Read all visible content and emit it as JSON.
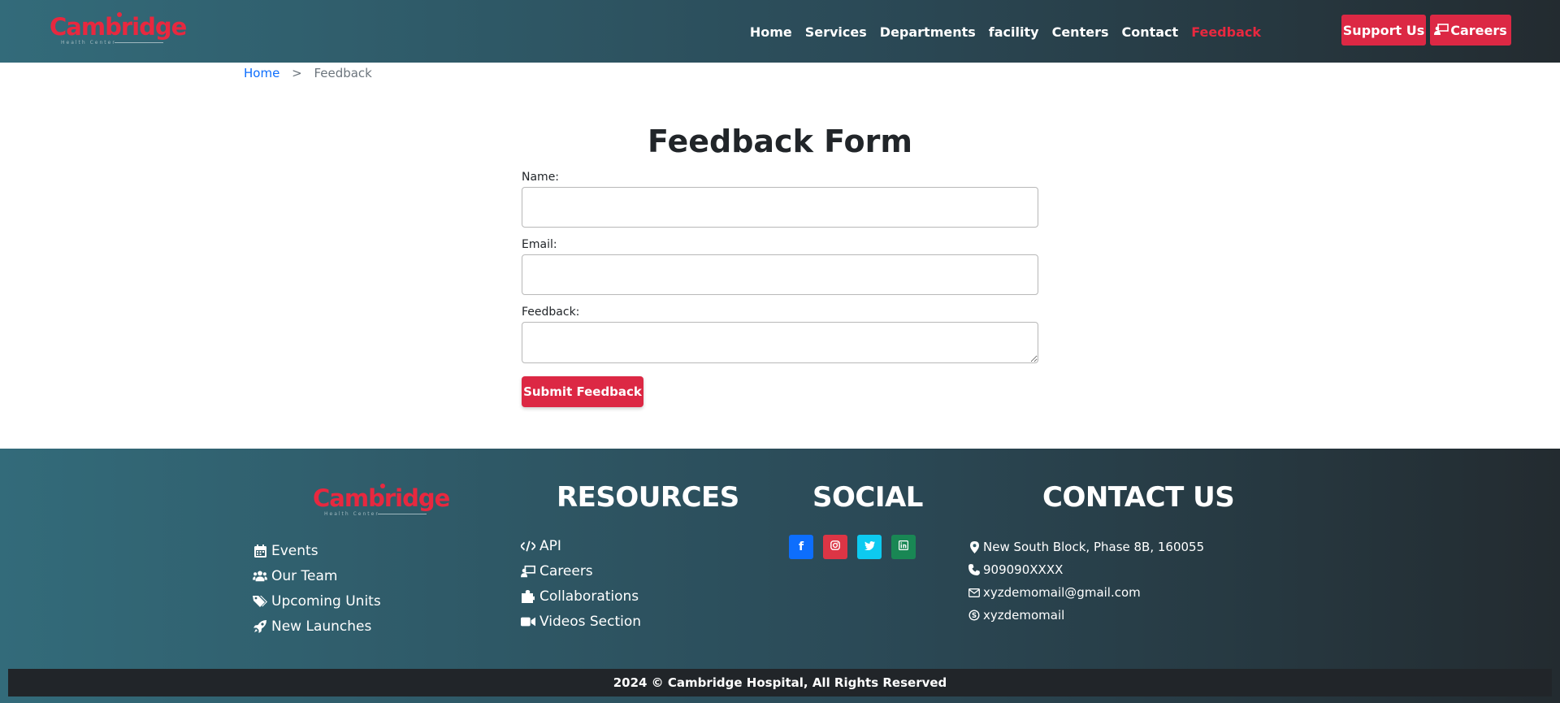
{
  "brand": {
    "name": "Cambridge",
    "subtitle": "Health Center"
  },
  "nav": {
    "items": [
      {
        "label": "Home"
      },
      {
        "label": "Services"
      },
      {
        "label": "Departments"
      },
      {
        "label": "facility"
      },
      {
        "label": "Centers"
      },
      {
        "label": "Contact"
      },
      {
        "label": "Feedback"
      }
    ],
    "support_label": "Support Us",
    "careers_label": "Careers"
  },
  "breadcrumb": {
    "home": "Home",
    "separator": ">",
    "current": "Feedback"
  },
  "form": {
    "title": "Feedback Form",
    "name_label": "Name:",
    "email_label": "Email:",
    "feedback_label": "Feedback:",
    "submit_label": "Submit Feedback"
  },
  "footer": {
    "left_links": [
      {
        "label": "Events",
        "icon": "calendar-icon"
      },
      {
        "label": "Our Team",
        "icon": "users-icon"
      },
      {
        "label": "Upcoming Units",
        "icon": "tags-icon"
      },
      {
        "label": "New Launches",
        "icon": "rocket-icon"
      }
    ],
    "resources_heading": "RESOURCES",
    "resources": [
      {
        "label": "API",
        "icon": "code-icon"
      },
      {
        "label": "Careers",
        "icon": "chalkboard-user-icon"
      },
      {
        "label": "Collaborations",
        "icon": "puzzle-icon"
      },
      {
        "label": "Videos Section",
        "icon": "video-icon"
      }
    ],
    "social_heading": "SOCIAL",
    "socials": [
      {
        "name": "facebook",
        "glyph": "f",
        "color": "#0d6efd"
      },
      {
        "name": "instagram",
        "glyph": "◎",
        "color": "#dc3545"
      },
      {
        "name": "twitter",
        "glyph": "t",
        "color": "#0dcaf0"
      },
      {
        "name": "linkedin",
        "glyph": "in",
        "color": "#198754"
      }
    ],
    "contact_heading": "CONTACT US",
    "contact": {
      "address": "New South Block, Phase 8B, 160055",
      "phone": "909090XXXX",
      "email": "xyzdemomail@gmail.com",
      "skype": "xyzdemomail"
    },
    "copyright": "2024 © Cambridge Hospital, All Rights Reserved"
  },
  "colors": {
    "accent": "#dc2844",
    "nav_gradient_start": "#336b7a",
    "nav_gradient_end": "#232b30"
  }
}
